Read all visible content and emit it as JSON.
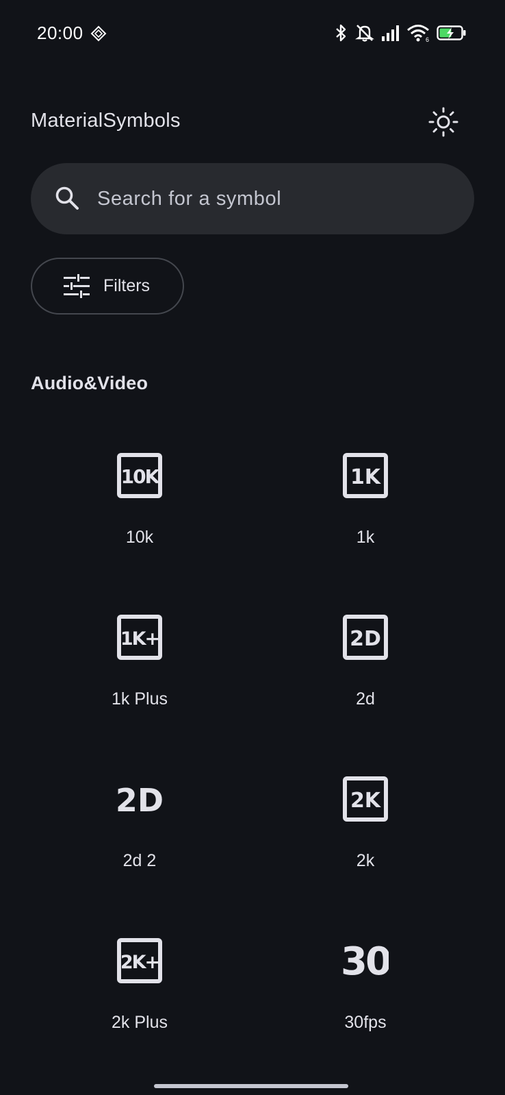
{
  "status_bar": {
    "time": "20:00",
    "icons": [
      "diamond-icon",
      "bluetooth-icon",
      "muted-bell-icon",
      "signal-icon",
      "wifi-icon",
      "battery-charging-icon"
    ]
  },
  "app": {
    "title": "MaterialSymbols",
    "theme_icon": "sun-icon"
  },
  "search": {
    "placeholder": "Search for a symbol",
    "value": ""
  },
  "filters": {
    "label": "Filters"
  },
  "section": {
    "title": "Audio&Video",
    "items": [
      {
        "label": "10k",
        "glyph": "10K"
      },
      {
        "label": "1k",
        "glyph": "1K"
      },
      {
        "label": "1k Plus",
        "glyph": "1K+"
      },
      {
        "label": "2d",
        "glyph": "2D"
      },
      {
        "label": "2d 2",
        "glyph": "2D"
      },
      {
        "label": "2k",
        "glyph": "2K"
      },
      {
        "label": "2k Plus",
        "glyph": "2K+"
      },
      {
        "label": "30fps",
        "glyph": "30"
      }
    ]
  },
  "colors": {
    "background": "#111318",
    "search_bg": "#282a2f",
    "text": "#e2e2e9",
    "outline": "#44474e",
    "battery_green": "#4cd964"
  }
}
